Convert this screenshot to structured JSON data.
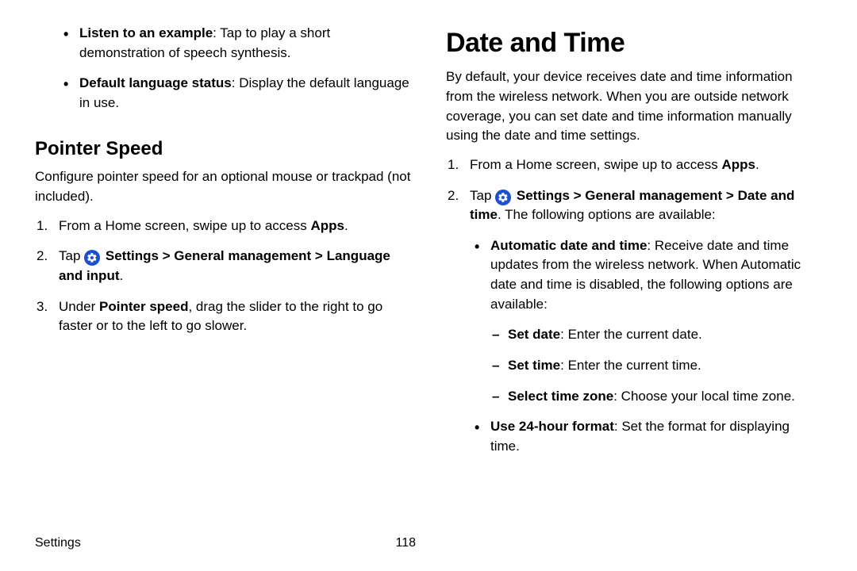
{
  "left": {
    "topBullets": [
      {
        "bold": "Listen to an example",
        "rest": ": Tap to play a short demonstration of speech synthesis."
      },
      {
        "bold": "Default language status",
        "rest": ": Display the default language in use."
      }
    ],
    "pointer": {
      "heading": "Pointer Speed",
      "intro": "Configure pointer speed for an optional mouse or trackpad (not included).",
      "step1_a": "From a Home screen, swipe up to access ",
      "step1_b": "Apps",
      "step1_c": ".",
      "step2_a": "Tap ",
      "step2_path": "Settings > General management > Language and input",
      "step2_c": ".",
      "step3_a": "Under ",
      "step3_b": "Pointer speed",
      "step3_c": ", drag the slider to the right to go faster or to the left to go slower."
    }
  },
  "right": {
    "heading": "Date and Time",
    "intro": "By default, your device receives date and time information from the wireless network. When you are outside network coverage, you can set date and time information manually using the date and time settings.",
    "step1_a": "From a Home screen, swipe up to access ",
    "step1_b": "Apps",
    "step1_c": ".",
    "step2_a": "Tap ",
    "step2_path": "Settings > General management > Date and time",
    "step2_c": ". The following options are available:",
    "bullets": [
      {
        "bold": "Automatic date and time",
        "rest": ": Receive date and time updates from the wireless network. When Automatic date and time is disabled, the following options are available:"
      }
    ],
    "dashes": [
      {
        "bold": "Set date",
        "rest": ": Enter the current date."
      },
      {
        "bold": "Set time",
        "rest": ": Enter the current time."
      },
      {
        "bold": "Select time zone",
        "rest": ": Choose your local time zone."
      }
    ],
    "lastBullet": {
      "bold": "Use 24-hour format",
      "rest": ": Set the format for displaying time."
    }
  },
  "footer": {
    "section": "Settings",
    "page": "118"
  }
}
